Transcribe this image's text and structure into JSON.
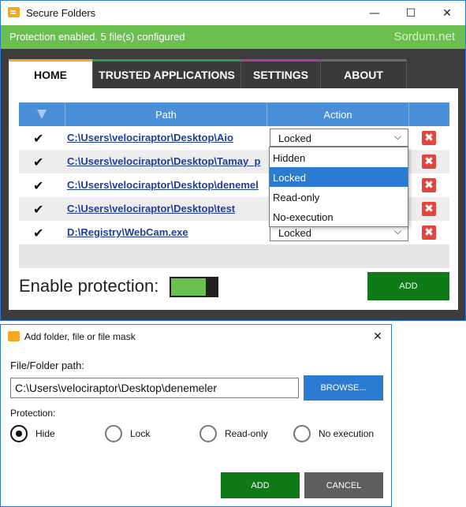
{
  "window": {
    "title": "Secure Folders",
    "minimize_glyph": "—",
    "maximize_glyph": "☐",
    "close_glyph": "✕"
  },
  "status": {
    "text": "Protection enabled. 5 file(s) configured",
    "brand": "Sordum.net",
    "color": "#6bbf4e"
  },
  "tabs": [
    {
      "label": "HOME",
      "active": true
    },
    {
      "label": "TRUSTED APPLICATIONS",
      "active": false
    },
    {
      "label": "SETTINGS",
      "active": false
    },
    {
      "label": "ABOUT",
      "active": false
    }
  ],
  "table": {
    "columns": {
      "path": "Path",
      "action": "Action"
    },
    "rows": [
      {
        "checked": true,
        "path": "C:\\Users\\velociraptor\\Desktop\\Aio",
        "action": "Locked"
      },
      {
        "checked": true,
        "path": "C:\\Users\\velociraptor\\Desktop\\Tamay_p",
        "action": "Locked"
      },
      {
        "checked": true,
        "path": "C:\\Users\\velociraptor\\Desktop\\denemel",
        "action": "Locked"
      },
      {
        "checked": true,
        "path": "C:\\Users\\velociraptor\\Desktop\\test",
        "action": "Locked"
      },
      {
        "checked": true,
        "path": "D:\\Registry\\WebCam.exe",
        "action": "Locked"
      }
    ],
    "check_glyph": "✔",
    "delete_glyph": "✖",
    "chevron_glyph": "⌵"
  },
  "action_dropdown": {
    "options": [
      "Hidden",
      "Locked",
      "Read-only",
      "No-execution"
    ],
    "selected": "Locked"
  },
  "enable_protection": {
    "label": "Enable protection:",
    "on": true
  },
  "main_add_label": "ADD",
  "dialog": {
    "title": "Add folder, file or file mask",
    "close_glyph": "✕",
    "path_label": "File/Folder path:",
    "path_value": "C:\\Users\\velociraptor\\Desktop\\denemeler",
    "browse_label": "BROWSE...",
    "protection_label": "Protection:",
    "options": [
      {
        "label": "Hide",
        "selected": true
      },
      {
        "label": "Lock",
        "selected": false
      },
      {
        "label": "Read-only",
        "selected": false
      },
      {
        "label": "No execution",
        "selected": false
      }
    ],
    "add_label": "ADD",
    "cancel_label": "CANCEL"
  },
  "colors": {
    "accent_blue": "#2b7bd0",
    "add_green": "#0f7b16",
    "delete_red": "#e2453c",
    "header_blue": "#4a90d9"
  }
}
